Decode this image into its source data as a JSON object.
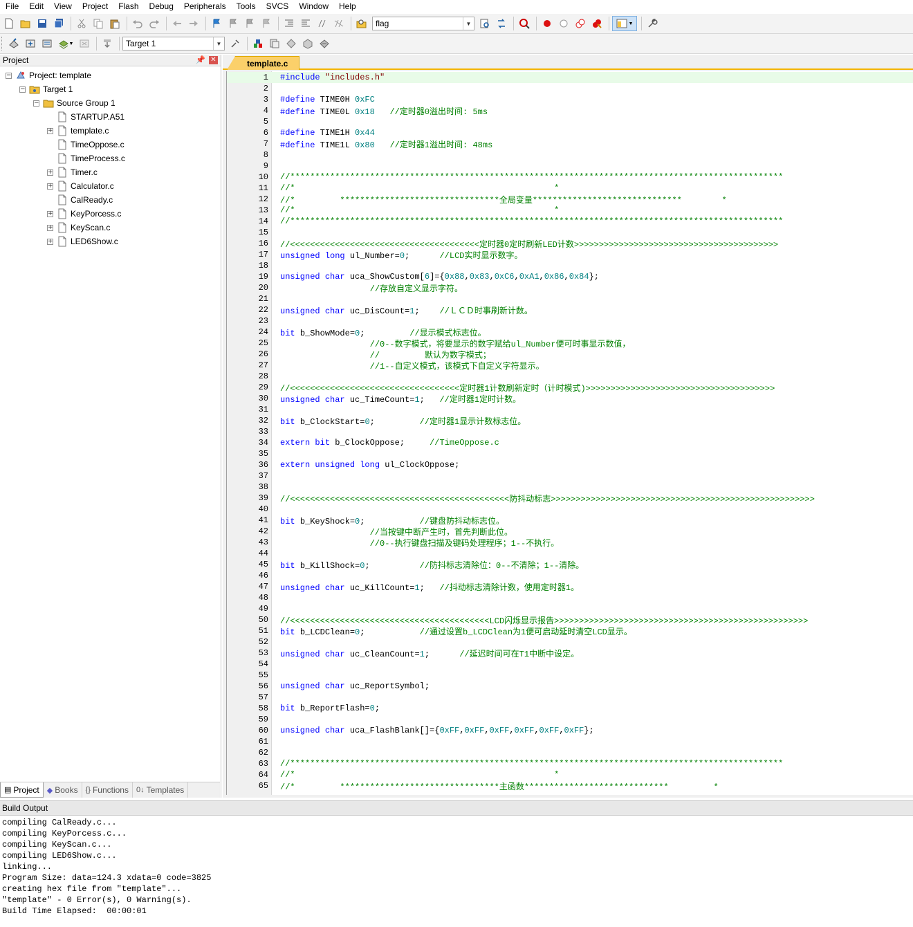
{
  "menu": [
    "File",
    "Edit",
    "View",
    "Project",
    "Flash",
    "Debug",
    "Peripherals",
    "Tools",
    "SVCS",
    "Window",
    "Help"
  ],
  "toolbar": {
    "find_combo_value": "flag",
    "target_combo_value": "Target 1"
  },
  "project_panel": {
    "title": "Project",
    "tree": {
      "project": "Project: template",
      "target": "Target 1",
      "group": "Source Group 1",
      "files": [
        {
          "name": "STARTUP.A51",
          "expandable": false
        },
        {
          "name": "template.c",
          "expandable": true
        },
        {
          "name": "TimeOppose.c",
          "expandable": false
        },
        {
          "name": "TimeProcess.c",
          "expandable": false
        },
        {
          "name": "Timer.c",
          "expandable": true
        },
        {
          "name": "Calculator.c",
          "expandable": true
        },
        {
          "name": "CalReady.c",
          "expandable": false
        },
        {
          "name": "KeyPorcess.c",
          "expandable": true
        },
        {
          "name": "KeyScan.c",
          "expandable": true
        },
        {
          "name": "LED6Show.c",
          "expandable": true
        }
      ]
    },
    "tabs": [
      "Project",
      "Books",
      "Functions",
      "Templates"
    ]
  },
  "editor": {
    "active_tab": "template.c",
    "lines": [
      [
        [
          "pp",
          "#include "
        ],
        [
          "str",
          "\"includes.h\""
        ]
      ],
      [],
      [
        [
          "pp",
          "#define "
        ],
        [
          "t",
          "TIME0H "
        ],
        [
          "num",
          "0xFC"
        ]
      ],
      [
        [
          "pp",
          "#define "
        ],
        [
          "t",
          "TIME0L "
        ],
        [
          "num",
          "0x18"
        ],
        [
          "t",
          "   "
        ],
        [
          "cm",
          "//定时器0溢出时间: 5ms"
        ]
      ],
      [],
      [
        [
          "pp",
          "#define "
        ],
        [
          "t",
          "TIME1H "
        ],
        [
          "num",
          "0x44"
        ]
      ],
      [
        [
          "pp",
          "#define "
        ],
        [
          "t",
          "TIME1L "
        ],
        [
          "num",
          "0x80"
        ],
        [
          "t",
          "   "
        ],
        [
          "cm",
          "//定时器1溢出时间: 48ms"
        ]
      ],
      [],
      [],
      [
        [
          "cm",
          "//***************************************************************************************************"
        ]
      ],
      [
        [
          "cm",
          "//*                                                    *"
        ]
      ],
      [
        [
          "cm",
          "//*         ********************************全局变量******************************        *"
        ]
      ],
      [
        [
          "cm",
          "//*                                                    *"
        ]
      ],
      [
        [
          "cm",
          "//***************************************************************************************************"
        ]
      ],
      [],
      [
        [
          "cm",
          "//<<<<<<<<<<<<<<<<<<<<<<<<<<<<<<<<<<<<<<定时器0定时刷新LED计数>>>>>>>>>>>>>>>>>>>>>>>>>>>>>>>>>>>>>>>>>"
        ]
      ],
      [
        [
          "kw",
          "unsigned "
        ],
        [
          "kw",
          "long "
        ],
        [
          "t",
          "ul_Number="
        ],
        [
          "num",
          "0"
        ],
        [
          "t",
          ";      "
        ],
        [
          "cm",
          "//LCD实时显示数字。"
        ]
      ],
      [],
      [
        [
          "kw",
          "unsigned "
        ],
        [
          "kw",
          "char "
        ],
        [
          "t",
          "uca_ShowCustom["
        ],
        [
          "num",
          "6"
        ],
        [
          "t",
          "]={"
        ],
        [
          "num",
          "0x88"
        ],
        [
          "t",
          ","
        ],
        [
          "num",
          "0x83"
        ],
        [
          "t",
          ","
        ],
        [
          "num",
          "0xC6"
        ],
        [
          "t",
          ","
        ],
        [
          "num",
          "0xA1"
        ],
        [
          "t",
          ","
        ],
        [
          "num",
          "0x86"
        ],
        [
          "t",
          ","
        ],
        [
          "num",
          "0x84"
        ],
        [
          "t",
          "};"
        ]
      ],
      [
        [
          "t",
          "                  "
        ],
        [
          "cm",
          "//存放自定义显示字符。"
        ]
      ],
      [],
      [
        [
          "kw",
          "unsigned "
        ],
        [
          "kw",
          "char "
        ],
        [
          "t",
          "uc_DisCount="
        ],
        [
          "num",
          "1"
        ],
        [
          "t",
          ";    "
        ],
        [
          "cm",
          "//ＬＣＤ时事刷新计数。"
        ]
      ],
      [],
      [
        [
          "kw",
          "bit "
        ],
        [
          "t",
          "b_ShowMode="
        ],
        [
          "num",
          "0"
        ],
        [
          "t",
          ";         "
        ],
        [
          "cm",
          "//显示模式标志位。"
        ]
      ],
      [
        [
          "t",
          "                  "
        ],
        [
          "cm",
          "//0--数字模式，将要显示的数字赋给ul_Number便可时事显示数值，"
        ]
      ],
      [
        [
          "t",
          "                  "
        ],
        [
          "cm",
          "//         默认为数字模式；"
        ]
      ],
      [
        [
          "t",
          "                  "
        ],
        [
          "cm",
          "//1--自定义模式，该模式下自定义字符显示。"
        ]
      ],
      [],
      [
        [
          "cm",
          "//<<<<<<<<<<<<<<<<<<<<<<<<<<<<<<<<<<定时器1计数刷新定时（计时模式)>>>>>>>>>>>>>>>>>>>>>>>>>>>>>>>>>>>>>>"
        ]
      ],
      [
        [
          "kw",
          "unsigned "
        ],
        [
          "kw",
          "char "
        ],
        [
          "t",
          "uc_TimeCount="
        ],
        [
          "num",
          "1"
        ],
        [
          "t",
          ";   "
        ],
        [
          "cm",
          "//定时器1定时计数。"
        ]
      ],
      [],
      [
        [
          "kw",
          "bit "
        ],
        [
          "t",
          "b_ClockStart="
        ],
        [
          "num",
          "0"
        ],
        [
          "t",
          ";         "
        ],
        [
          "cm",
          "//定时器1显示计数标志位。"
        ]
      ],
      [],
      [
        [
          "kw",
          "extern "
        ],
        [
          "kw",
          "bit "
        ],
        [
          "t",
          "b_ClockOppose;     "
        ],
        [
          "cm",
          "//TimeOppose.c"
        ]
      ],
      [],
      [
        [
          "kw",
          "extern "
        ],
        [
          "kw",
          "unsigned "
        ],
        [
          "kw",
          "long "
        ],
        [
          "t",
          "ul_ClockOppose;"
        ]
      ],
      [],
      [],
      [
        [
          "cm",
          "//<<<<<<<<<<<<<<<<<<<<<<<<<<<<<<<<<<<<<<<<<<<<防抖动标志>>>>>>>>>>>>>>>>>>>>>>>>>>>>>>>>>>>>>>>>>>>>>>>>>>>>>"
        ]
      ],
      [],
      [
        [
          "kw",
          "bit "
        ],
        [
          "t",
          "b_KeyShock="
        ],
        [
          "num",
          "0"
        ],
        [
          "t",
          ";           "
        ],
        [
          "cm",
          "//键盘防抖动标志位。"
        ]
      ],
      [
        [
          "t",
          "                  "
        ],
        [
          "cm",
          "//当按键中断产生时，首先判断此位。"
        ]
      ],
      [
        [
          "t",
          "                  "
        ],
        [
          "cm",
          "//0--执行键盘扫描及键码处理程序；1--不执行。"
        ]
      ],
      [],
      [
        [
          "kw",
          "bit "
        ],
        [
          "t",
          "b_KillShock="
        ],
        [
          "num",
          "0"
        ],
        [
          "t",
          ";          "
        ],
        [
          "cm",
          "//防抖标志清除位：0--不清除；1--清除。"
        ]
      ],
      [],
      [
        [
          "kw",
          "unsigned "
        ],
        [
          "kw",
          "char "
        ],
        [
          "t",
          "uc_KillCount="
        ],
        [
          "num",
          "1"
        ],
        [
          "t",
          ";   "
        ],
        [
          "cm",
          "//抖动标志清除计数，使用定时器1。"
        ]
      ],
      [],
      [],
      [
        [
          "cm",
          "//<<<<<<<<<<<<<<<<<<<<<<<<<<<<<<<<<<<<<<<<LCD闪烁显示报告>>>>>>>>>>>>>>>>>>>>>>>>>>>>>>>>>>>>>>>>>>>>>>>>>>>"
        ]
      ],
      [
        [
          "kw",
          "bit "
        ],
        [
          "t",
          "b_LCDClean="
        ],
        [
          "num",
          "0"
        ],
        [
          "t",
          ";           "
        ],
        [
          "cm",
          "//通过设置b_LCDClean为1便可启动延时清空LCD显示。"
        ]
      ],
      [],
      [
        [
          "kw",
          "unsigned "
        ],
        [
          "kw",
          "char "
        ],
        [
          "t",
          "uc_CleanCount="
        ],
        [
          "num",
          "1"
        ],
        [
          "t",
          ";      "
        ],
        [
          "cm",
          "//延迟时间可在T1中断中设定。"
        ]
      ],
      [],
      [],
      [
        [
          "kw",
          "unsigned "
        ],
        [
          "kw",
          "char "
        ],
        [
          "t",
          "uc_ReportSymbol;"
        ]
      ],
      [],
      [
        [
          "kw",
          "bit "
        ],
        [
          "t",
          "b_ReportFlash="
        ],
        [
          "num",
          "0"
        ],
        [
          "t",
          ";"
        ]
      ],
      [],
      [
        [
          "kw",
          "unsigned "
        ],
        [
          "kw",
          "char "
        ],
        [
          "t",
          "uca_FlashBlank[]={"
        ],
        [
          "num",
          "0xFF"
        ],
        [
          "t",
          ","
        ],
        [
          "num",
          "0xFF"
        ],
        [
          "t",
          ","
        ],
        [
          "num",
          "0xFF"
        ],
        [
          "t",
          ","
        ],
        [
          "num",
          "0xFF"
        ],
        [
          "t",
          ","
        ],
        [
          "num",
          "0xFF"
        ],
        [
          "t",
          ","
        ],
        [
          "num",
          "0xFF"
        ],
        [
          "t",
          "};"
        ]
      ],
      [],
      [],
      [
        [
          "cm",
          "//***************************************************************************************************"
        ]
      ],
      [
        [
          "cm",
          "//*                                                    *"
        ]
      ],
      [
        [
          "cm",
          "//*         ********************************主函数*****************************         *"
        ]
      ]
    ]
  },
  "build_output": {
    "title": "Build Output",
    "lines": [
      "compiling CalReady.c...",
      "compiling KeyPorcess.c...",
      "compiling KeyScan.c...",
      "compiling LED6Show.c...",
      "linking...",
      "Program Size: data=124.3 xdata=0 code=3825",
      "creating hex file from \"template\"...",
      "\"template\" - 0 Error(s), 0 Warning(s).",
      "Build Time Elapsed:  00:00:01"
    ]
  }
}
